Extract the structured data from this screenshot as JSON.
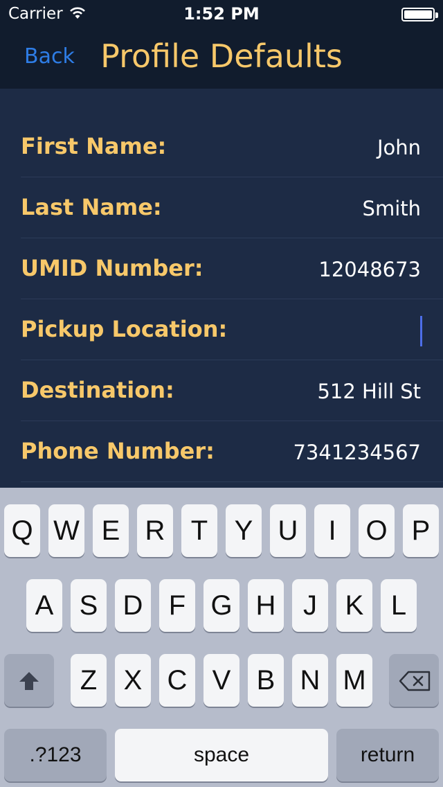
{
  "status_bar": {
    "carrier": "Carrier",
    "time": "1:52 PM",
    "battery_level": 1.0
  },
  "nav": {
    "back_label": "Back",
    "title": "Profile Defaults"
  },
  "form": {
    "first_name": {
      "label": "First Name:",
      "value": "John"
    },
    "last_name": {
      "label": "Last Name:",
      "value": "Smith"
    },
    "umid": {
      "label": "UMID Number:",
      "value": "12048673"
    },
    "pickup": {
      "label": "Pickup Location:",
      "value": ""
    },
    "destination": {
      "label": "Destination:",
      "value": "512 Hill St"
    },
    "phone": {
      "label": "Phone Number:",
      "value": "7341234567"
    }
  },
  "keyboard": {
    "row1": [
      "Q",
      "W",
      "E",
      "R",
      "T",
      "Y",
      "U",
      "I",
      "O",
      "P"
    ],
    "row2": [
      "A",
      "S",
      "D",
      "F",
      "G",
      "H",
      "J",
      "K",
      "L"
    ],
    "row3": [
      "Z",
      "X",
      "C",
      "V",
      "B",
      "N",
      "M"
    ],
    "numbers_label": ".?123",
    "space_label": "space",
    "return_label": "return",
    "shift_icon": "shift-icon",
    "delete_icon": "backspace-icon"
  },
  "colors": {
    "nav_background": "#111c2d",
    "form_background": "#1d2b45",
    "label_gold": "#f7c86a",
    "back_blue": "#2e7de6",
    "cursor_blue": "#4d6ee8",
    "keyboard_background": "#b6bccb"
  }
}
